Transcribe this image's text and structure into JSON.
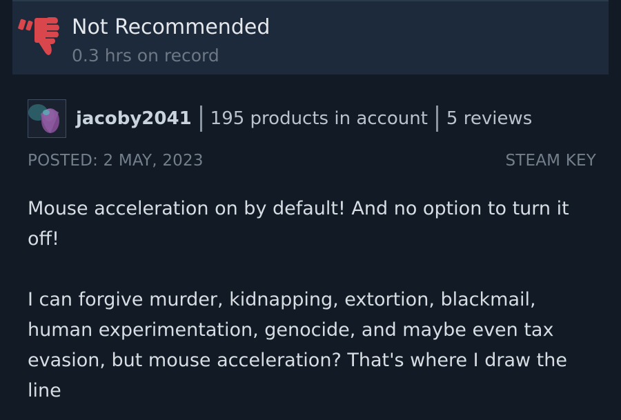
{
  "review": {
    "recommendation": "Not Recommended",
    "hours": "0.3 hrs on record",
    "thumb_icon": "thumbs-down-icon",
    "thumb_color": "#d9474c"
  },
  "author": {
    "username": "jacoby2041",
    "products": "195 products in account",
    "reviews": "5 reviews"
  },
  "meta": {
    "posted": "POSTED: 2 MAY, 2023",
    "key_type": "STEAM KEY"
  },
  "body": {
    "paragraph_1": "Mouse acceleration on by default! And no option to turn it off!",
    "paragraph_2": "I can forgive murder, kidnapping, extortion, blackmail, human experimentation, genocide, and maybe even tax evasion, but mouse acceleration? That's where I draw the line"
  }
}
